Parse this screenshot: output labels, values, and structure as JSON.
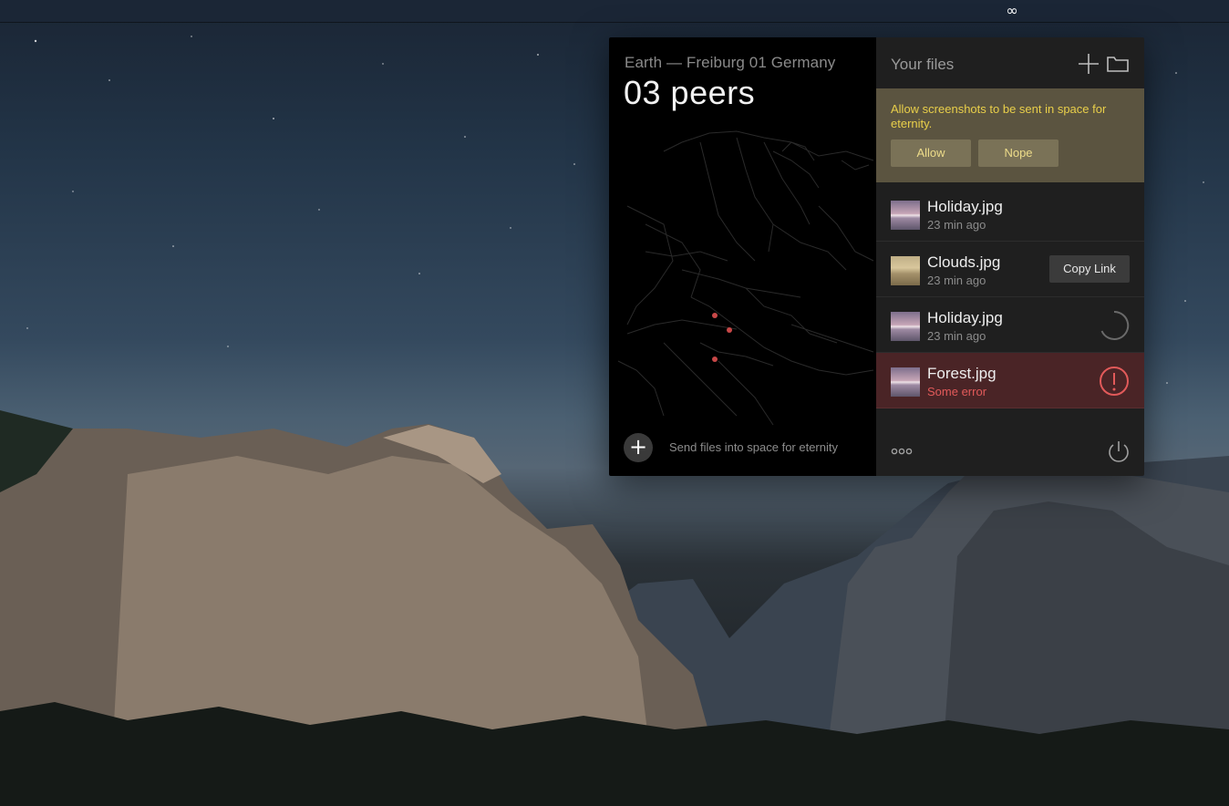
{
  "menubar": {
    "app_icon": "infinity-icon",
    "app_glyph": "∞"
  },
  "left_panel": {
    "location": "Earth — Freiburg 01 Germany",
    "peers": "03 peers",
    "send_icon": "plus-icon",
    "send_glyph": "+",
    "send_label": "Send files into space for eternity",
    "peer_color": "#c84848"
  },
  "right_panel": {
    "title": "Your files",
    "notice": {
      "text": "Allow screenshots to be sent in space for eternity.",
      "allow_label": "Allow",
      "nope_label": "Nope"
    },
    "files": [
      {
        "name": "Holiday.jpg",
        "meta": "23 min ago",
        "state": "done"
      },
      {
        "name": "Clouds.jpg",
        "meta": "23 min ago",
        "state": "copy",
        "action_label": "Copy Link"
      },
      {
        "name": "Holiday.jpg",
        "meta": "23 min ago",
        "state": "uploading"
      },
      {
        "name": "Forest.jpg",
        "meta": "Some error",
        "state": "error"
      }
    ]
  },
  "colors": {
    "accent_error": "#e25a5a",
    "notice_bg": "#5b5440",
    "notice_text": "#e9cf4a"
  }
}
